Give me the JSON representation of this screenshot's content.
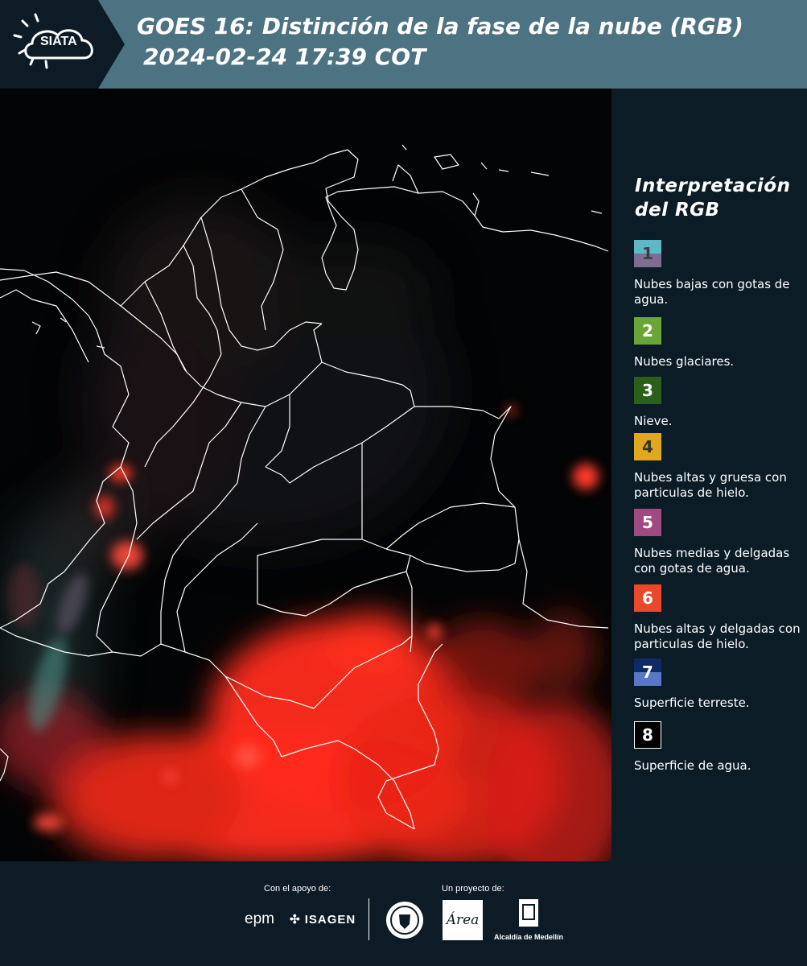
{
  "header": {
    "logo_text": "SIATA",
    "title_line1": "GOES 16: Distinción de la fase de la nube (RGB)",
    "title_line2": "2024-02-24 17:39 COT"
  },
  "colors": {
    "header_bg": "#4d7282",
    "page_bg": "#0d1b26",
    "map_bg": "#030405",
    "cloud_red": "#ff2a1a"
  },
  "legend": {
    "title": "Interpretación del RGB",
    "items": [
      {
        "number": "1",
        "label": "Nubes bajas con gotas de agua.",
        "color": "#5fb8c6",
        "color2": "#7d6d8e"
      },
      {
        "number": "2",
        "label": "Nubes glaciares.",
        "color": "#6aa637"
      },
      {
        "number": "3",
        "label": "Nieve.",
        "color": "#2c5e1c"
      },
      {
        "number": "4",
        "label": "Nubes altas y gruesa con particulas de hielo.",
        "color": "#e0a81c"
      },
      {
        "number": "5",
        "label": "Nubes medias y delgadas con gotas de agua.",
        "color": "#a04a82"
      },
      {
        "number": "6",
        "label": "Nubes altas y delgadas con particulas de hielo.",
        "color": "#e9492a"
      },
      {
        "number": "7",
        "label": "Superficie terreste.",
        "color": "#0f2a66",
        "color2": "#5878c6"
      },
      {
        "number": "8",
        "label": "Superficie de agua.",
        "color": "#000000"
      }
    ]
  },
  "footer": {
    "support_caption": "Con el apoyo de:",
    "project_caption": "Un proyecto de:",
    "epm_logo": "epm",
    "isagen_logo": "ISAGEN",
    "area_logo": "Área",
    "alcaldia_logo": "Alcaldía de Medellín"
  }
}
